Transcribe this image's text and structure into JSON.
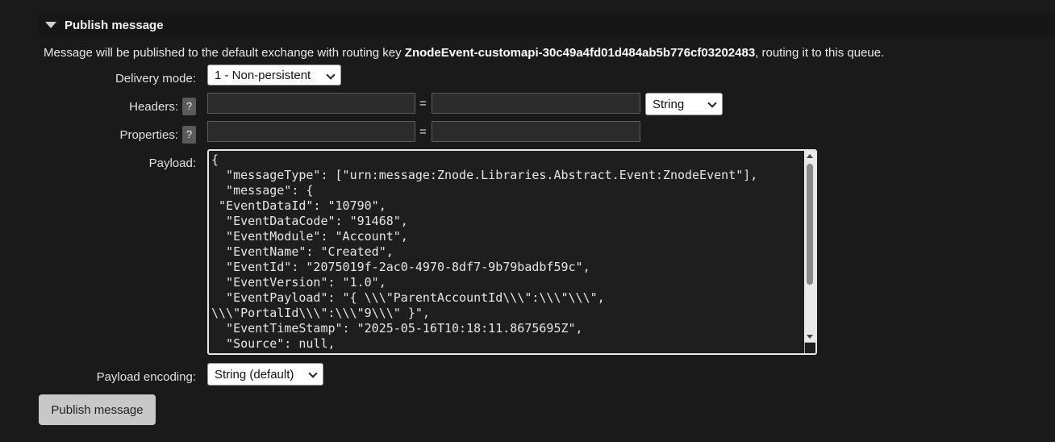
{
  "section": {
    "title": "Publish message"
  },
  "info": {
    "prefix": "Message will be published to the default exchange with routing key ",
    "routing_key": "ZnodeEvent-customapi-30c49a4fd01d484ab5b776cf03202483",
    "suffix": ", routing it to this queue."
  },
  "form": {
    "delivery_mode_label": "Delivery mode:",
    "delivery_mode_value": "1 - Non-persistent",
    "headers_label": "Headers:",
    "headers_help": "?",
    "headers_type_value": "String",
    "properties_label": "Properties:",
    "properties_help": "?",
    "equals": "=",
    "payload_label": "Payload:",
    "payload_text": "{\n  \"messageType\": [\"urn:message:Znode.Libraries.Abstract.Event:ZnodeEvent\"],\n  \"message\": {\n \"EventDataId\": \"10790\",\n  \"EventDataCode\": \"91468\",\n  \"EventModule\": \"Account\",\n  \"EventName\": \"Created\",\n  \"EventId\": \"2075019f-2ac0-4970-8df7-9b79badbf59c\",\n  \"EventVersion\": \"1.0\",\n  \"EventPayload\": \"{ \\\\\\\"ParentAccountId\\\\\\\":\\\\\\\"\\\\\\\",\n\\\\\\\"PortalId\\\\\\\":\\\\\\\"9\\\\\\\" }\",\n  \"EventTimeStamp\": \"2025-05-16T10:18:11.8675695Z\",\n  \"Source\": null,",
    "payload_encoding_label": "Payload encoding:",
    "payload_encoding_value": "String (default)"
  },
  "actions": {
    "publish_label": "Publish message"
  }
}
